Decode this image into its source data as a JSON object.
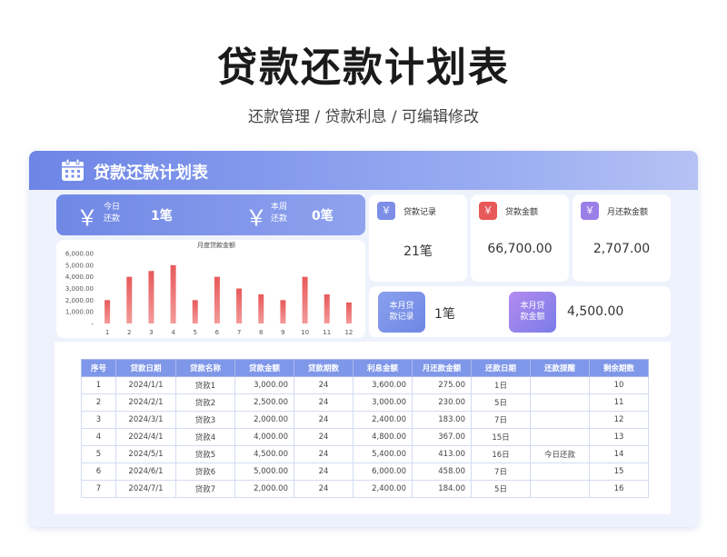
{
  "page": {
    "title": "贷款还款计划表",
    "subtitle": "还款管理 / 贷款利息 /  可编辑修改"
  },
  "card": {
    "title": "贷款还款计划表",
    "today": {
      "yen": "￥",
      "label_line1": "今日",
      "label_line2": "还款",
      "value": "1笔"
    },
    "week": {
      "yen": "￥",
      "label_line1": "本周",
      "label_line2": "还款",
      "value": "0笔"
    }
  },
  "stats": [
    {
      "icon": "￥",
      "label": "贷款记录",
      "value": "21笔",
      "color": "#7c8ee6"
    },
    {
      "icon": "￥",
      "label": "贷款金额",
      "value": "66,700.00",
      "color": "#e8595a"
    },
    {
      "icon": "￥",
      "label": "月还款金额",
      "value": "2,707.00",
      "color": "#9b7fe8"
    }
  ],
  "month": {
    "records_label_line1": "本月贷",
    "records_label_line2": "款记录",
    "records_value": "1笔",
    "amount_label_line1": "本月贷",
    "amount_label_line2": "款金额",
    "amount_value": "4,500.00"
  },
  "chart_data": {
    "type": "bar",
    "title": "月度贷款金额",
    "categories": [
      "1",
      "2",
      "3",
      "4",
      "5",
      "6",
      "7",
      "8",
      "9",
      "10",
      "11",
      "12"
    ],
    "values": [
      2000,
      4000,
      4500,
      5000,
      2000,
      4000,
      3000,
      2500,
      2000,
      4000,
      2500,
      1800
    ],
    "y_ticks": [
      "6,000.00",
      "5,000.00",
      "4,000.00",
      "3,000.00",
      "2,000.00",
      "1,000.00",
      "-"
    ],
    "ylim": [
      0,
      6000
    ],
    "grid": false,
    "bar_color": "#e8595a"
  },
  "table": {
    "headers": [
      "序号",
      "贷款日期",
      "贷款名称",
      "贷款金额",
      "贷款期数",
      "利息金额",
      "月还款金额",
      "还款日期",
      "还款提醒",
      "剩余期数"
    ],
    "rows": [
      [
        "1",
        "2024/1/1",
        "贷款1",
        "3,000.00",
        "24",
        "3,600.00",
        "275.00",
        "1日",
        "",
        "10"
      ],
      [
        "2",
        "2024/2/1",
        "贷款2",
        "2,500.00",
        "24",
        "3,000.00",
        "230.00",
        "5日",
        "",
        "11"
      ],
      [
        "3",
        "2024/3/1",
        "贷款3",
        "2,000.00",
        "24",
        "2,400.00",
        "183.00",
        "7日",
        "",
        "12"
      ],
      [
        "4",
        "2024/4/1",
        "贷款4",
        "4,000.00",
        "24",
        "4,800.00",
        "367.00",
        "15日",
        "",
        "13"
      ],
      [
        "5",
        "2024/5/1",
        "贷款5",
        "4,500.00",
        "24",
        "5,400.00",
        "413.00",
        "16日",
        "今日还款",
        "14"
      ],
      [
        "6",
        "2024/6/1",
        "贷款6",
        "5,000.00",
        "24",
        "6,000.00",
        "458.00",
        "7日",
        "",
        "15"
      ],
      [
        "7",
        "2024/7/1",
        "贷款7",
        "2,000.00",
        "24",
        "2,400.00",
        "184.00",
        "5日",
        "",
        "16"
      ]
    ]
  }
}
